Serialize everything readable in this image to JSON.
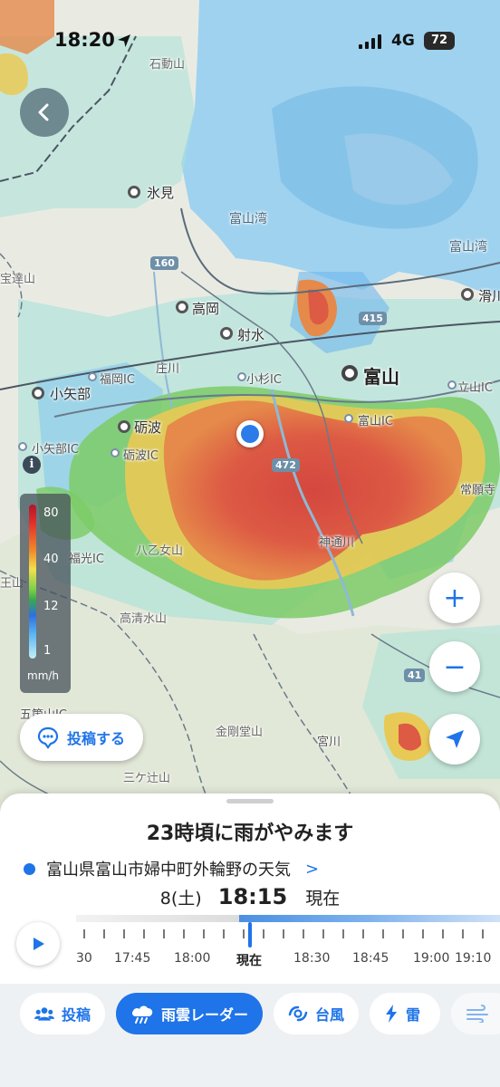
{
  "status_bar": {
    "time": "18:20",
    "network": "4G",
    "battery": "72"
  },
  "map": {
    "labels": {
      "himi": "氷見",
      "sekidozan": "石動山",
      "toyamawan": "富山湾",
      "toyamawan2": "富山湾",
      "takaoka": "高岡",
      "imizu": "射水",
      "toyama": "富山",
      "oyabe": "小矢部",
      "tonami": "砺波",
      "fukuoka_ic": "福岡IC",
      "shosen_ic": "庄川",
      "kosugi_ic": "小杉IC",
      "toyama_ic": "富山IC",
      "tateyama_ic": "立山IC",
      "oyabe_ic": "小矢部IC",
      "tonami_ic": "砺波IC",
      "namerikawa": "滑川",
      "houdatsusan": "宝達山",
      "yatomeyama": "八乙女山",
      "takashozu": "高清水山",
      "kongodosan": "金剛堂山",
      "mikatsuji": "三ケ辻山",
      "jinzugawa": "神通川",
      "jouganji": "常願寺",
      "miyagawa": "宮川",
      "gokaIC": "五箇山IC",
      "fukumitsu_ic": "福光IC",
      "iozen": "王山",
      "route160": "160",
      "route415": "415",
      "route472": "472",
      "route41": "41"
    },
    "legend": {
      "ticks": [
        "80",
        "40",
        "12",
        "1"
      ],
      "unit": "mm/h"
    },
    "post_button": "投稿する",
    "zoom_in": "+",
    "zoom_out": "−"
  },
  "sheet": {
    "headline": "23時頃に雨がやみます",
    "location": "富山県富山市婦中町外輪野の天気",
    "date": "8(土)",
    "clock": "18:15",
    "now_suffix": "現在",
    "timeline_labels": [
      "30",
      "17:45",
      "18:00",
      "現在",
      "18:30",
      "18:45",
      "19:00",
      "19:10"
    ]
  },
  "tabs": [
    "投稿",
    "雨雲レーダー",
    "台風",
    "雷"
  ],
  "colors": {
    "accent": "#1e74e8",
    "rain_heavy": "#d9534f",
    "sea": "#8cc6ea"
  }
}
